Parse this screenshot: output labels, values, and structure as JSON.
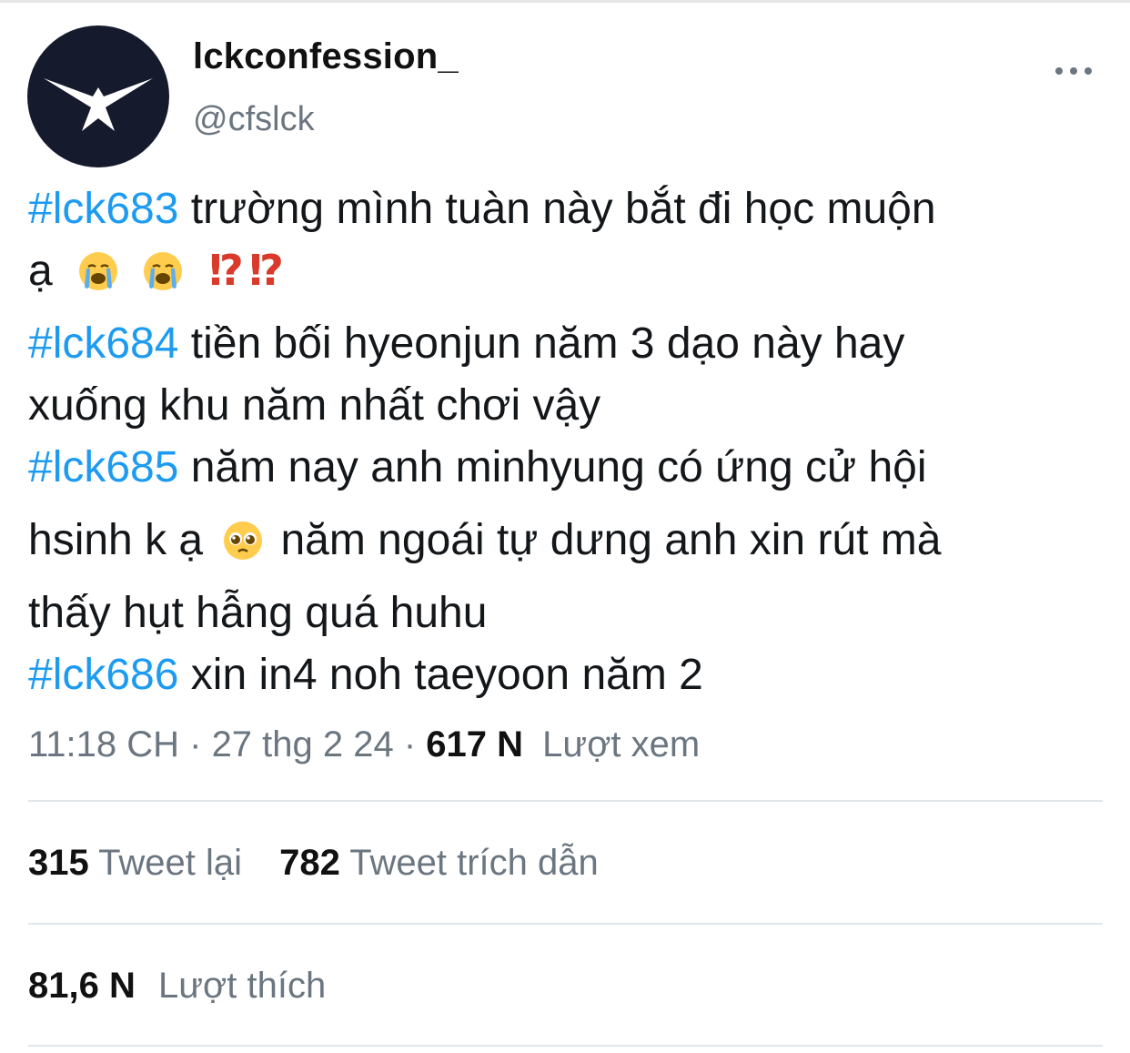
{
  "author": {
    "display_name": "lckconfession_",
    "handle": "@cfslck",
    "avatar_icon": "eagle-logo-icon"
  },
  "more_icon": "more-horizontal-icon",
  "tweet": {
    "lines": [
      {
        "hashtag": "#lck683",
        "text": " trường mình tuàn này bắt đi học muộn"
      },
      {
        "text": "ạ"
      },
      {
        "hashtag": "#lck684",
        "text": " tiền bối hyeonjun năm 3 dạo này hay"
      },
      {
        "text": "xuống khu năm nhất chơi vậy"
      },
      {
        "hashtag": "#lck685",
        "text": " năm nay anh minhyung có ứng cử hội"
      },
      {
        "text_before": "hsinh k ạ",
        "text_after": "năm ngoái tự dưng anh xin rút mà"
      },
      {
        "text": "thấy hụt hẫng quá huhu"
      },
      {
        "hashtag": "#lck686",
        "text": " xin in4 noh taeyoon năm 2"
      }
    ],
    "emojis": {
      "crying": "loudly-crying-face-emoji",
      "interrobang": "⁉",
      "pleading": "pleading-face-emoji"
    }
  },
  "meta": {
    "time": "11:18 CH",
    "sep1": " · ",
    "date": "27 thg 2 24",
    "sep2": " · ",
    "views_count": "617 N",
    "views_label": "Lượt xem"
  },
  "stats": {
    "retweets_count": "315",
    "retweets_label": "Tweet lại",
    "quotes_count": "782",
    "quotes_label": "Tweet trích dẫn",
    "likes_count": "81,6 N",
    "likes_label": "Lượt thích"
  },
  "colors": {
    "link": "#1d9bf0",
    "secondary_text": "#6b7680",
    "avatar_bg": "#161a2d",
    "interrobang": "#d93a2a"
  }
}
